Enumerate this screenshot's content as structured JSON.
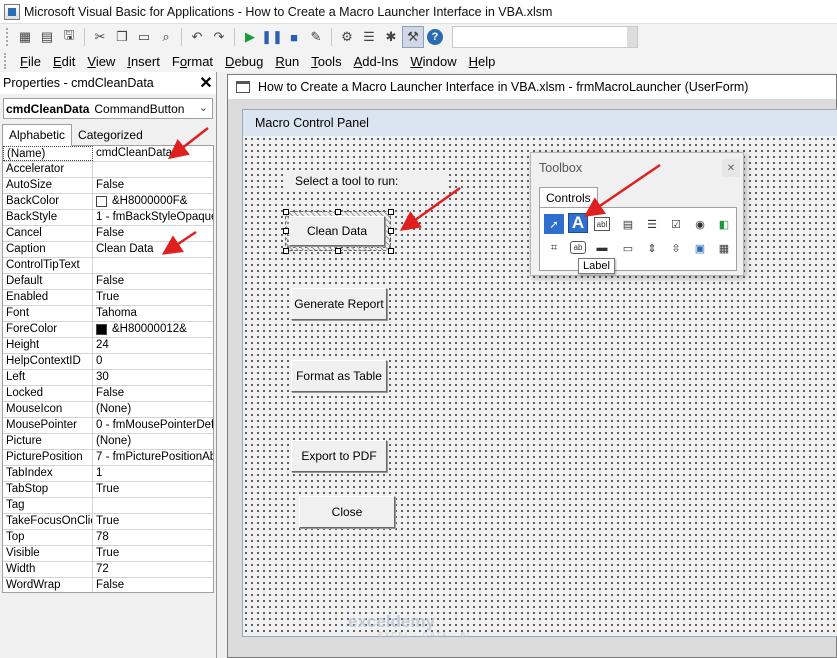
{
  "window": {
    "title": "Microsoft Visual Basic for Applications - How to Create a Macro Launcher Interface in VBA.xlsm"
  },
  "toolbar": {
    "icons": [
      "excel-icon",
      "insert-userform-icon",
      "save-icon",
      "cut-icon",
      "copy-icon",
      "paste-icon",
      "find-icon",
      "undo-icon",
      "redo-icon",
      "run-icon",
      "break-icon",
      "reset-icon",
      "design-mode-icon",
      "project-explorer-icon",
      "properties-icon",
      "object-browser-icon",
      "toolbox-icon",
      "help-icon"
    ]
  },
  "menu": [
    {
      "label": "File",
      "u": "F",
      "rest": "ile"
    },
    {
      "label": "Edit",
      "u": "E",
      "rest": "dit"
    },
    {
      "label": "View",
      "u": "V",
      "rest": "iew"
    },
    {
      "label": "Insert",
      "u": "I",
      "rest": "nsert"
    },
    {
      "label": "Format",
      "u": "o",
      "pre": "F",
      "rest": "rmat"
    },
    {
      "label": "Debug",
      "u": "D",
      "rest": "ebug"
    },
    {
      "label": "Run",
      "u": "R",
      "rest": "un"
    },
    {
      "label": "Tools",
      "u": "T",
      "rest": "ools"
    },
    {
      "label": "Add-Ins",
      "u": "A",
      "rest": "dd-Ins"
    },
    {
      "label": "Window",
      "u": "W",
      "rest": "indow"
    },
    {
      "label": "Help",
      "u": "H",
      "rest": "elp"
    }
  ],
  "properties": {
    "title": "Properties - cmdCleanData",
    "object_name": "cmdCleanData",
    "object_type": "CommandButton",
    "tabs": [
      "Alphabetic",
      "Categorized"
    ],
    "rows": [
      {
        "k": "(Name)",
        "v": "cmdCleanData"
      },
      {
        "k": "Accelerator",
        "v": ""
      },
      {
        "k": "AutoSize",
        "v": "False"
      },
      {
        "k": "BackColor",
        "v": "&H8000000F&",
        "swatch": "#ffffff"
      },
      {
        "k": "BackStyle",
        "v": "1 - fmBackStyleOpaque"
      },
      {
        "k": "Cancel",
        "v": "False"
      },
      {
        "k": "Caption",
        "v": "Clean Data"
      },
      {
        "k": "ControlTipText",
        "v": ""
      },
      {
        "k": "Default",
        "v": "False"
      },
      {
        "k": "Enabled",
        "v": "True"
      },
      {
        "k": "Font",
        "v": "Tahoma"
      },
      {
        "k": "ForeColor",
        "v": "&H80000012&",
        "swatch": "#000000"
      },
      {
        "k": "Height",
        "v": "24"
      },
      {
        "k": "HelpContextID",
        "v": "0"
      },
      {
        "k": "Left",
        "v": "30"
      },
      {
        "k": "Locked",
        "v": "False"
      },
      {
        "k": "MouseIcon",
        "v": "(None)"
      },
      {
        "k": "MousePointer",
        "v": "0 - fmMousePointerDefault"
      },
      {
        "k": "Picture",
        "v": "(None)"
      },
      {
        "k": "PicturePosition",
        "v": "7 - fmPicturePositionAboveCenter"
      },
      {
        "k": "TabIndex",
        "v": "1"
      },
      {
        "k": "TabStop",
        "v": "True"
      },
      {
        "k": "Tag",
        "v": ""
      },
      {
        "k": "TakeFocusOnClick",
        "v": "True"
      },
      {
        "k": "Top",
        "v": "78"
      },
      {
        "k": "Visible",
        "v": "True"
      },
      {
        "k": "Width",
        "v": "72"
      },
      {
        "k": "WordWrap",
        "v": "False"
      }
    ]
  },
  "designer": {
    "title": "How to Create a Macro Launcher Interface in VBA.xlsm - frmMacroLauncher (UserForm)",
    "form_caption": "Macro Control Panel",
    "label_text": "Select a tool to run:",
    "buttons": {
      "clean": "Clean Data",
      "report": "Generate Report",
      "format": "Format as Table",
      "export": "Export to PDF",
      "close": "Close"
    }
  },
  "toolbox": {
    "title": "Toolbox",
    "tab": "Controls",
    "tooltip": "Label",
    "label_glyph": "A",
    "textbox_glyph": "abl",
    "togglebutton_glyph": "ab",
    "tools": [
      "select-objects-icon",
      "label-icon",
      "textbox-icon",
      "combobox-icon",
      "listbox-icon",
      "checkbox-icon",
      "optionbutton-icon",
      "togglebutton-icon",
      "frame-icon",
      "commandbutton-icon",
      "tabstrip-icon",
      "multipage-icon",
      "scrollbar-icon",
      "spinbutton-icon",
      "image-icon",
      "refedit-icon"
    ]
  },
  "watermark": {
    "brand": "exceldemy",
    "tagline": "EXCEL · DATA · BI"
  },
  "colors": {
    "arrow": "#e02020",
    "selection": "#2f6fd0"
  }
}
